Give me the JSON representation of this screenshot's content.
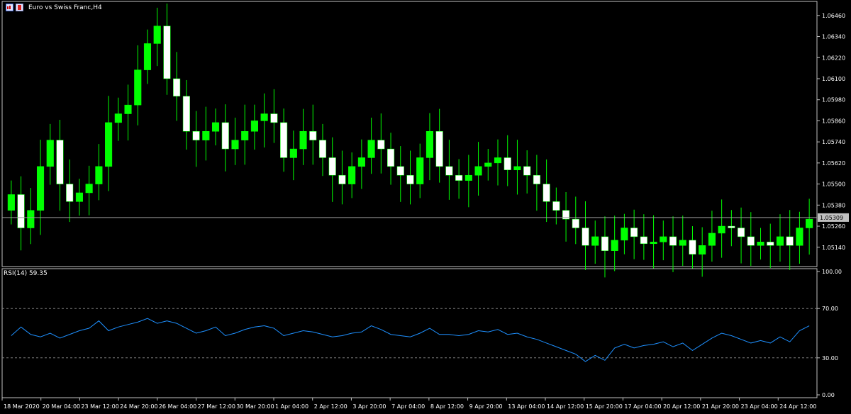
{
  "window": {
    "title": "Euro vs Swiss Franc,H4",
    "icon_left": "chart-window-icon",
    "icon_right": "flag-icon"
  },
  "colors": {
    "background": "#000000",
    "frame": "#c0c0c0",
    "bull_candle": "#00ff00",
    "bear_candle": "#ffffff",
    "rsi_line": "#1e90ff",
    "level_line": "#808080",
    "current_price_tag": "#c0c0c0"
  },
  "indicator": {
    "label": "RSI(14) 59.35",
    "levels": [
      "100.00",
      "70.00",
      "30.00",
      "0.00"
    ]
  },
  "price_tag": "1.05309",
  "chart_data": [
    {
      "type": "candlestick",
      "symbol": "EURCHF",
      "timeframe": "H4",
      "y_ticks": [
        "1.06460",
        "1.06340",
        "1.06220",
        "1.06100",
        "1.05980",
        "1.05860",
        "1.05740",
        "1.05620",
        "1.05500",
        "1.05380",
        "1.05260",
        "1.05140"
      ],
      "ylim": [
        1.0503,
        1.0654
      ],
      "current_price": 1.05309,
      "x_tick_labels": [
        "18 Mar 2020",
        "20 Mar 04:00",
        "23 Mar 12:00",
        "24 Mar 20:00",
        "26 Mar 04:00",
        "27 Mar 12:00",
        "30 Mar 20:00",
        "1 Apr 04:00",
        "2 Apr 12:00",
        "3 Apr 20:00",
        "7 Apr 04:00",
        "8 Apr 12:00",
        "9 Apr 20:00",
        "13 Apr 04:00",
        "14 Apr 12:00",
        "15 Apr 20:00",
        "17 Apr 04:00",
        "20 Apr 12:00",
        "21 Apr 20:00",
        "23 Apr 04:00",
        "24 Apr 12:00"
      ],
      "close": [
        1.0544,
        1.0525,
        1.0535,
        1.056,
        1.0575,
        1.055,
        1.054,
        1.0545,
        1.055,
        1.056,
        1.0585,
        1.059,
        1.0595,
        1.0615,
        1.063,
        1.064,
        1.061,
        1.06,
        1.058,
        1.0575,
        1.058,
        1.0585,
        1.057,
        1.0575,
        1.058,
        1.0586,
        1.059,
        1.0585,
        1.0565,
        1.057,
        1.058,
        1.0575,
        1.0565,
        1.0555,
        1.055,
        1.056,
        1.0565,
        1.0575,
        1.057,
        1.056,
        1.0555,
        1.055,
        1.0565,
        1.058,
        1.056,
        1.0555,
        1.0552,
        1.0555,
        1.056,
        1.0562,
        1.0565,
        1.0558,
        1.056,
        1.0555,
        1.055,
        1.054,
        1.0535,
        1.053,
        1.0525,
        1.0515,
        1.052,
        1.0512,
        1.0518,
        1.0525,
        1.052,
        1.0516,
        1.0517,
        1.052,
        1.0515,
        1.0518,
        1.051,
        1.0515,
        1.0522,
        1.0526,
        1.0525,
        1.052,
        1.0515,
        1.0517,
        1.0515,
        1.052,
        1.0515,
        1.0525,
        1.053
      ],
      "open": [
        1.0535,
        1.0544,
        1.0525,
        1.0535,
        1.056,
        1.0575,
        1.055,
        1.054,
        1.0545,
        1.055,
        1.056,
        1.0585,
        1.059,
        1.0595,
        1.0615,
        1.063,
        1.064,
        1.061,
        1.06,
        1.058,
        1.0575,
        1.058,
        1.0585,
        1.057,
        1.0575,
        1.058,
        1.0586,
        1.059,
        1.0585,
        1.0565,
        1.057,
        1.058,
        1.0575,
        1.0565,
        1.0555,
        1.055,
        1.056,
        1.0565,
        1.0575,
        1.057,
        1.056,
        1.0555,
        1.055,
        1.0565,
        1.058,
        1.056,
        1.0555,
        1.0552,
        1.0555,
        1.056,
        1.0562,
        1.0565,
        1.0558,
        1.056,
        1.0555,
        1.055,
        1.054,
        1.0535,
        1.053,
        1.0525,
        1.0515,
        1.052,
        1.0512,
        1.0518,
        1.0525,
        1.052,
        1.0516,
        1.0517,
        1.052,
        1.0515,
        1.0518,
        1.051,
        1.0515,
        1.0522,
        1.0526,
        1.0525,
        1.052,
        1.0515,
        1.0517,
        1.0515,
        1.052,
        1.0515,
        1.0525
      ],
      "rsi": [
        48,
        55,
        49,
        47,
        50,
        46,
        49,
        52,
        54,
        60,
        52,
        55,
        57,
        59,
        62,
        58,
        60,
        58,
        54,
        50,
        52,
        55,
        48,
        50,
        53,
        55,
        56,
        54,
        48,
        50,
        52,
        51,
        49,
        47,
        48,
        50,
        51,
        56,
        53,
        49,
        48,
        47,
        50,
        54,
        49,
        49,
        48,
        49,
        52,
        51,
        53,
        49,
        50,
        47,
        45,
        42,
        39,
        36,
        33,
        27,
        32,
        28,
        38,
        41,
        38,
        40,
        41,
        43,
        39,
        42,
        36,
        41,
        46,
        50,
        48,
        45,
        42,
        44,
        42,
        47,
        43,
        52,
        56
      ]
    },
    {
      "type": "line",
      "title": "RSI(14) 59.35",
      "ylim": [
        0,
        100
      ],
      "levels": [
        70,
        30
      ]
    }
  ]
}
